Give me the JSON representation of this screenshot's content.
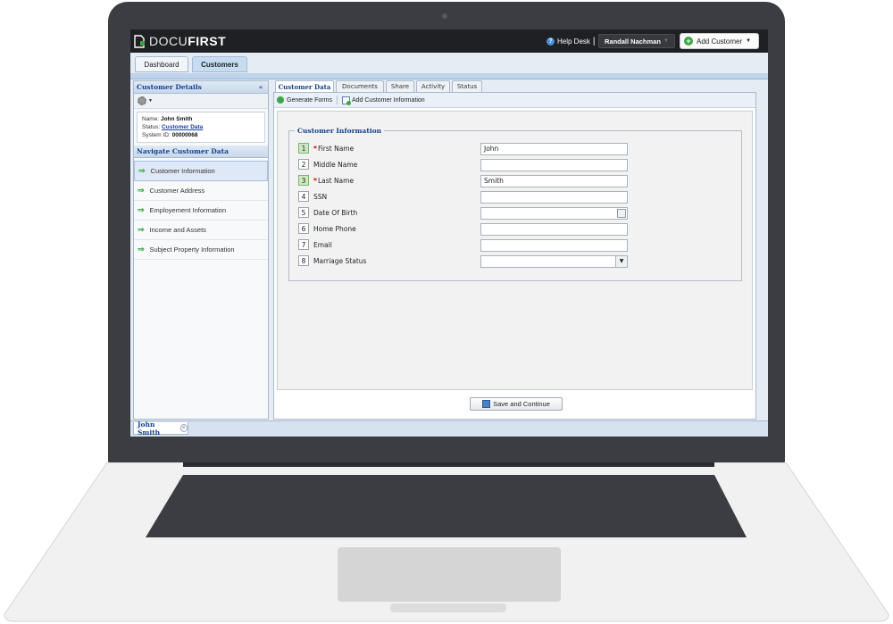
{
  "app": {
    "logo_light": "DOCU",
    "logo_bold": "FIRST",
    "help_label": "Help Desk",
    "help_separator": "|",
    "user_name": "Randall Nachman",
    "add_customer_label": "Add Customer"
  },
  "main_tabs": [
    {
      "label": "Dashboard",
      "active": false
    },
    {
      "label": "Customers",
      "active": true
    }
  ],
  "left_panel": {
    "title": "Customer Details",
    "collapse_glyph": "«",
    "name_label": "Name:",
    "name_value": "John Smith",
    "status_label": "Status:",
    "status_value": "Customer Data",
    "system_id_label": "System ID:",
    "system_id_value": "00000068",
    "nav_title": "Navigate Customer Data",
    "nav_items": [
      {
        "label": "Customer Information",
        "selected": true
      },
      {
        "label": "Customer Address",
        "selected": false
      },
      {
        "label": "Employement Information",
        "selected": false
      },
      {
        "label": "Income and Assets",
        "selected": false
      },
      {
        "label": "Subject Property Information",
        "selected": false
      }
    ]
  },
  "sub_tabs": [
    {
      "label": "Customer Data",
      "active": true
    },
    {
      "label": "Documents",
      "active": false
    },
    {
      "label": "Share",
      "active": false
    },
    {
      "label": "Activity",
      "active": false
    },
    {
      "label": "Status",
      "active": false
    }
  ],
  "toolbar": {
    "generate_forms": "Generate Forms",
    "add_customer_info": "Add Customer Information"
  },
  "form": {
    "legend": "Customer Information",
    "fields": [
      {
        "num": "1",
        "label": "First Name",
        "required": true,
        "value": "John",
        "kind": "text"
      },
      {
        "num": "2",
        "label": "Middle Name",
        "required": false,
        "value": "",
        "kind": "text"
      },
      {
        "num": "3",
        "label": "Last Name",
        "required": true,
        "value": "Smith",
        "kind": "text"
      },
      {
        "num": "4",
        "label": "SSN",
        "required": false,
        "value": "",
        "kind": "text"
      },
      {
        "num": "5",
        "label": "Date Of Birth",
        "required": false,
        "value": "",
        "kind": "date"
      },
      {
        "num": "6",
        "label": "Home Phone",
        "required": false,
        "value": "",
        "kind": "text"
      },
      {
        "num": "7",
        "label": "Email",
        "required": false,
        "value": "",
        "kind": "text"
      },
      {
        "num": "8",
        "label": "Marriage Status",
        "required": false,
        "value": "",
        "kind": "select"
      }
    ],
    "required_marker": "*",
    "save_label": "Save and Continue"
  },
  "bottom_tab": {
    "label": "John Smith",
    "close_glyph": "×"
  },
  "colors": {
    "brand_dark": "#1f2023",
    "accent_green": "#3aa845",
    "header_blue": "#15428b",
    "laptop_body": "#3b3d42"
  }
}
